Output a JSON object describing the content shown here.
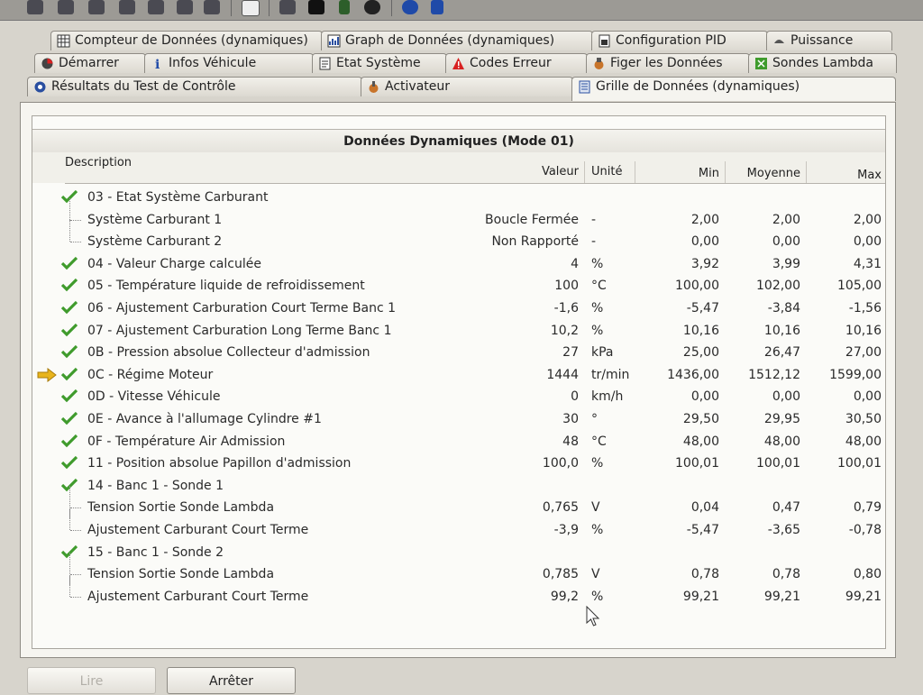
{
  "tabs_row1": [
    {
      "label": "Compteur de Données (dynamiques)",
      "icon": "grid-icon"
    },
    {
      "label": "Graph de Données (dynamiques)",
      "icon": "graph-icon"
    },
    {
      "label": "Configuration PID",
      "icon": "config-icon"
    },
    {
      "label": "Puissance",
      "icon": "power-icon"
    }
  ],
  "tabs_row2": [
    {
      "label": "Démarrer",
      "icon": "start-icon"
    },
    {
      "label": "Infos Véhicule",
      "icon": "info-icon"
    },
    {
      "label": "Etat Système",
      "icon": "system-icon"
    },
    {
      "label": "Codes Erreur",
      "icon": "warning-icon"
    },
    {
      "label": "Figer les Données",
      "icon": "freeze-icon"
    },
    {
      "label": "Sondes Lambda",
      "icon": "lambda-icon"
    }
  ],
  "tabs_row3": [
    {
      "label": "Résultats du Test de Contrôle",
      "icon": "test-icon"
    },
    {
      "label": "Activateur",
      "icon": "actuator-icon"
    },
    {
      "label": "Grille de Données (dynamiques)",
      "icon": "list-icon",
      "active": true
    }
  ],
  "panel": {
    "title": "Données Dynamiques (Mode 01)",
    "headers": {
      "description": "Description",
      "valeur": "Valeur",
      "unite": "Unité",
      "min": "Min",
      "moyenne": "Moyenne",
      "max": "Max"
    },
    "rows": [
      {
        "desc": "03 - Etat Système Carburant",
        "level": 0,
        "checked": true,
        "valeur": "",
        "unite": "",
        "min": "",
        "moy": "",
        "max": ""
      },
      {
        "desc": "Système Carburant 1",
        "level": 1,
        "checked": false,
        "valeur": "Boucle Fermée",
        "unite": "-",
        "min": "2,00",
        "moy": "2,00",
        "max": "2,00"
      },
      {
        "desc": "Système Carburant 2",
        "level": 1,
        "checked": false,
        "valeur": "Non Rapporté",
        "unite": "-",
        "min": "0,00",
        "moy": "0,00",
        "max": "0,00",
        "last": true
      },
      {
        "desc": "04 - Valeur Charge calculée",
        "level": 0,
        "checked": true,
        "valeur": "4",
        "unite": "%",
        "min": "3,92",
        "moy": "3,99",
        "max": "4,31"
      },
      {
        "desc": "05 - Température liquide de refroidissement",
        "level": 0,
        "checked": true,
        "valeur": "100",
        "unite": "°C",
        "min": "100,00",
        "moy": "102,00",
        "max": "105,00"
      },
      {
        "desc": "06 - Ajustement Carburation Court Terme Banc 1",
        "level": 0,
        "checked": true,
        "valeur": "-1,6",
        "unite": "%",
        "min": "-5,47",
        "moy": "-3,84",
        "max": "-1,56"
      },
      {
        "desc": "07 - Ajustement Carburation Long Terme Banc 1",
        "level": 0,
        "checked": true,
        "valeur": "10,2",
        "unite": "%",
        "min": "10,16",
        "moy": "10,16",
        "max": "10,16"
      },
      {
        "desc": "0B - Pression absolue Collecteur d'admission",
        "level": 0,
        "checked": true,
        "valeur": "27",
        "unite": "kPa",
        "min": "25,00",
        "moy": "26,47",
        "max": "27,00"
      },
      {
        "desc": "0C - Régime Moteur",
        "level": 0,
        "checked": true,
        "selected": true,
        "valeur": "1444",
        "unite": "tr/min",
        "min": "1436,00",
        "moy": "1512,12",
        "max": "1599,00"
      },
      {
        "desc": "0D - Vitesse Véhicule",
        "level": 0,
        "checked": true,
        "valeur": "0",
        "unite": "km/h",
        "min": "0,00",
        "moy": "0,00",
        "max": "0,00"
      },
      {
        "desc": "0E - Avance à l'allumage Cylindre #1",
        "level": 0,
        "checked": true,
        "valeur": "30",
        "unite": "°",
        "min": "29,50",
        "moy": "29,95",
        "max": "30,50"
      },
      {
        "desc": "0F - Température Air Admission",
        "level": 0,
        "checked": true,
        "valeur": "48",
        "unite": "°C",
        "min": "48,00",
        "moy": "48,00",
        "max": "48,00"
      },
      {
        "desc": "11 - Position absolue Papillon d'admission",
        "level": 0,
        "checked": true,
        "valeur": "100,0",
        "unite": "%",
        "min": "100,01",
        "moy": "100,01",
        "max": "100,01"
      },
      {
        "desc": "14 - Banc 1 - Sonde 1",
        "level": 0,
        "checked": true,
        "valeur": "",
        "unite": "",
        "min": "",
        "moy": "",
        "max": ""
      },
      {
        "desc": "Tension Sortie Sonde Lambda",
        "level": 1,
        "checked": false,
        "valeur": "0,765",
        "unite": "V",
        "min": "0,04",
        "moy": "0,47",
        "max": "0,79"
      },
      {
        "desc": "Ajustement Carburant Court Terme",
        "level": 1,
        "checked": false,
        "valeur": "-3,9",
        "unite": "%",
        "min": "-5,47",
        "moy": "-3,65",
        "max": "-0,78",
        "last": true
      },
      {
        "desc": "15 - Banc 1 - Sonde 2",
        "level": 0,
        "checked": true,
        "valeur": "",
        "unite": "",
        "min": "",
        "moy": "",
        "max": ""
      },
      {
        "desc": "Tension Sortie Sonde Lambda",
        "level": 1,
        "checked": false,
        "valeur": "0,785",
        "unite": "V",
        "min": "0,78",
        "moy": "0,78",
        "max": "0,80"
      },
      {
        "desc": "Ajustement Carburant Court Terme",
        "level": 1,
        "checked": false,
        "valeur": "99,2",
        "unite": "%",
        "min": "99,21",
        "moy": "99,21",
        "max": "99,21",
        "last": true
      }
    ]
  },
  "buttons": {
    "read_label": "Lire",
    "stop_label": "Arrêter"
  },
  "colors": {
    "check": "#3f9b2c",
    "arrow": "#e8b41c",
    "warning": "#d82020"
  }
}
